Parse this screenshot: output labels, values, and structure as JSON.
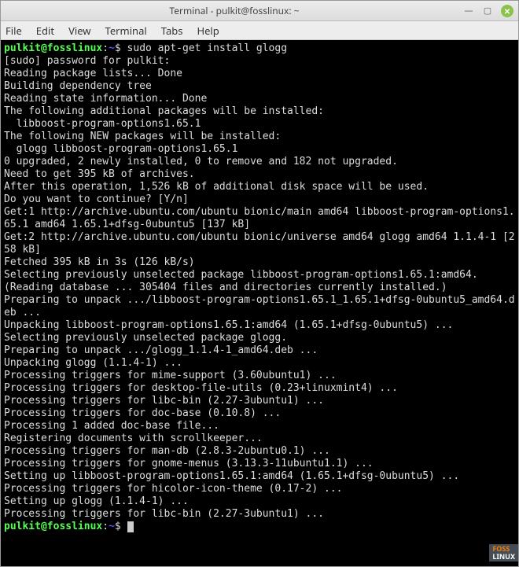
{
  "window": {
    "title": "Terminal - pulkit@fosslinux: ~"
  },
  "menubar": {
    "items": [
      "File",
      "Edit",
      "View",
      "Terminal",
      "Tabs",
      "Help"
    ]
  },
  "prompt": {
    "user_host": "pulkit@fosslinux",
    "colon": ":",
    "path": "~",
    "dollar": "$ "
  },
  "command": "sudo apt-get install glogg",
  "output_lines": [
    "[sudo] password for pulkit:",
    "Reading package lists... Done",
    "Building dependency tree",
    "Reading state information... Done",
    "The following additional packages will be installed:",
    "  libboost-program-options1.65.1",
    "The following NEW packages will be installed:",
    "  glogg libboost-program-options1.65.1",
    "0 upgraded, 2 newly installed, 0 to remove and 182 not upgraded.",
    "Need to get 395 kB of archives.",
    "After this operation, 1,526 kB of additional disk space will be used.",
    "Do you want to continue? [Y/n]",
    "Get:1 http://archive.ubuntu.com/ubuntu bionic/main amd64 libboost-program-options1.65.1 amd64 1.65.1+dfsg-0ubuntu5 [137 kB]",
    "Get:2 http://archive.ubuntu.com/ubuntu bionic/universe amd64 glogg amd64 1.1.4-1 [258 kB]",
    "Fetched 395 kB in 3s (126 kB/s)",
    "Selecting previously unselected package libboost-program-options1.65.1:amd64.",
    "(Reading database ... 305404 files and directories currently installed.)",
    "Preparing to unpack .../libboost-program-options1.65.1_1.65.1+dfsg-0ubuntu5_amd64.deb ...",
    "Unpacking libboost-program-options1.65.1:amd64 (1.65.1+dfsg-0ubuntu5) ...",
    "Selecting previously unselected package glogg.",
    "Preparing to unpack .../glogg_1.1.4-1_amd64.deb ...",
    "Unpacking glogg (1.1.4-1) ...",
    "Processing triggers for mime-support (3.60ubuntu1) ...",
    "Processing triggers for desktop-file-utils (0.23+linuxmint4) ...",
    "Processing triggers for libc-bin (2.27-3ubuntu1) ...",
    "Processing triggers for doc-base (0.10.8) ...",
    "Processing 1 added doc-base file...",
    "Registering documents with scrollkeeper...",
    "Processing triggers for man-db (2.8.3-2ubuntu0.1) ...",
    "Processing triggers for gnome-menus (3.13.3-11ubuntu1.1) ...",
    "Setting up libboost-program-options1.65.1:amd64 (1.65.1+dfsg-0ubuntu5) ...",
    "Processing triggers for hicolor-icon-theme (0.17-2) ...",
    "Setting up glogg (1.1.4-1) ...",
    "Processing triggers for libc-bin (2.27-3ubuntu1) ..."
  ],
  "watermark": {
    "foss": "FOSS",
    "linux": "LINUX"
  }
}
